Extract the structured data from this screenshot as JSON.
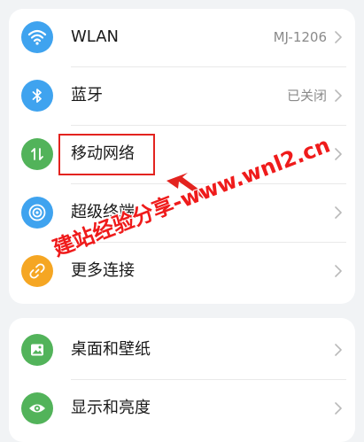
{
  "groups": [
    {
      "items": [
        {
          "label": "WLAN",
          "value": "MJ-1206",
          "icon": "wifi-icon",
          "icon_color": "#3fa3ef"
        },
        {
          "label": "蓝牙",
          "value": "已关闭",
          "icon": "bluetooth-icon",
          "icon_color": "#3fa3ef"
        },
        {
          "label": "移动网络",
          "value": "",
          "icon": "mobile-data-icon",
          "icon_color": "#52b35a"
        },
        {
          "label": "超级终端",
          "value": "",
          "icon": "super-device-icon",
          "icon_color": "#3fa3ef"
        },
        {
          "label": "更多连接",
          "value": "",
          "icon": "link-icon",
          "icon_color": "#f5a623"
        }
      ]
    },
    {
      "items": [
        {
          "label": "桌面和壁纸",
          "value": "",
          "icon": "wallpaper-icon",
          "icon_color": "#52b35a"
        },
        {
          "label": "显示和亮度",
          "value": "",
          "icon": "eye-icon",
          "icon_color": "#52b35a"
        }
      ]
    }
  ],
  "annotation": {
    "watermark": "建站经验分享-www.wnl2.cn",
    "color": "#e3231f"
  }
}
